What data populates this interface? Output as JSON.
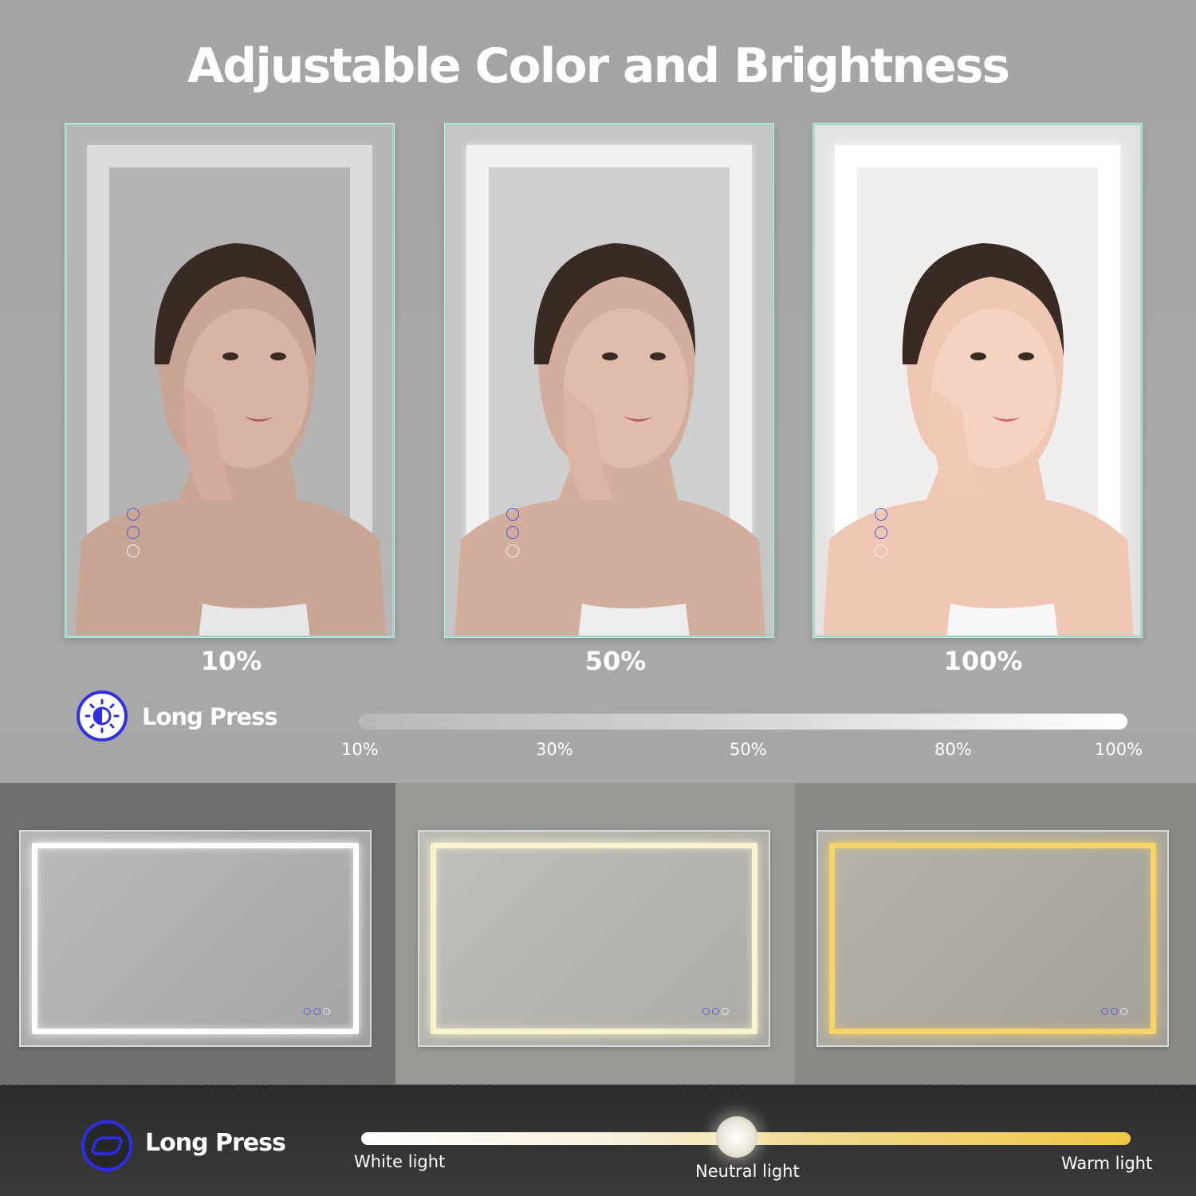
{
  "title": "Adjustable Color and Brightness",
  "brightness": {
    "mirrors": [
      {
        "label": "10%",
        "level": 10
      },
      {
        "label": "50%",
        "level": 50
      },
      {
        "label": "100%",
        "level": 100
      }
    ],
    "control_label": "Long Press",
    "icon": "sun-brightness-icon",
    "scale": [
      "10%",
      "30%",
      "50%",
      "80%",
      "100%"
    ]
  },
  "color_temperature": {
    "mirrors": [
      {
        "tone": "white",
        "light_color": "#ffffff"
      },
      {
        "tone": "neutral",
        "light_color": "#fbf3cf"
      },
      {
        "tone": "warm",
        "light_color": "#f5d56a"
      }
    ],
    "control_label": "Long Press",
    "icon": "color-cycle-icon",
    "scale": [
      "White light",
      "Neutral light",
      "Warm light"
    ],
    "selected": "Neutral light"
  },
  "colors": {
    "background": "#a9a9a9",
    "accent_blue": "#2d2de8",
    "bottom_bar": "#2c2c2c",
    "warm": "#efc646"
  }
}
